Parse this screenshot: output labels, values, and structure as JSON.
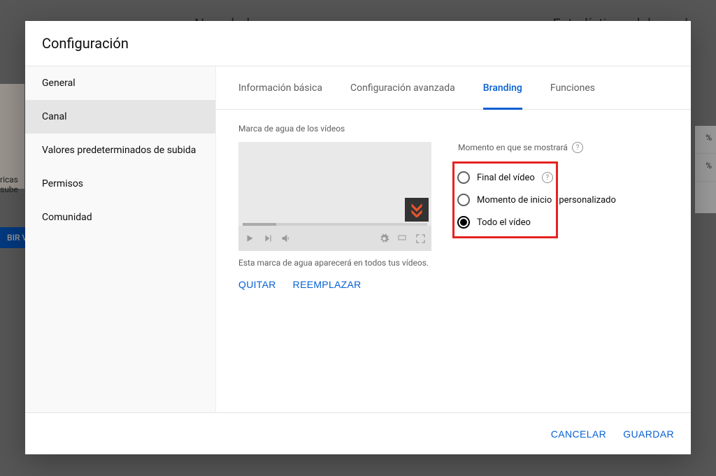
{
  "background": {
    "hint1": "Novedades",
    "hint2": "Estadísticas del canal",
    "left_line1": "ricas",
    "left_line2": "sube",
    "btn": "BIR V",
    "pct": "%"
  },
  "modal": {
    "title": "Configuración"
  },
  "sidebar": {
    "items": [
      {
        "label": "General"
      },
      {
        "label": "Canal"
      },
      {
        "label": "Valores predeterminados de subida"
      },
      {
        "label": "Permisos"
      },
      {
        "label": "Comunidad"
      }
    ],
    "selected_index": 1
  },
  "tabs": {
    "items": [
      {
        "label": "Información básica"
      },
      {
        "label": "Configuración avanzada"
      },
      {
        "label": "Branding"
      },
      {
        "label": "Funciones"
      }
    ],
    "active_index": 2
  },
  "watermark": {
    "section_label": "Marca de agua de los vídeos",
    "help_text": "Esta marca de agua aparecerá en todos tus vídeos.",
    "remove_label": "QUITAR",
    "replace_label": "REEMPLAZAR"
  },
  "display_time": {
    "header": "Momento en que se mostrará",
    "options": [
      {
        "label": "Final del vídeo",
        "help": true
      },
      {
        "label": "Momento de inicio personalizado",
        "help": false
      },
      {
        "label": "Todo el vídeo",
        "help": false
      }
    ],
    "selected_index": 2
  },
  "footer": {
    "cancel": "CANCELAR",
    "save": "GUARDAR"
  },
  "icons": {
    "play": "play-icon",
    "next": "next-icon",
    "volume": "volume-icon",
    "settings": "gear-icon",
    "theater": "theater-icon",
    "fullscreen": "fullscreen-icon",
    "help": "?"
  }
}
